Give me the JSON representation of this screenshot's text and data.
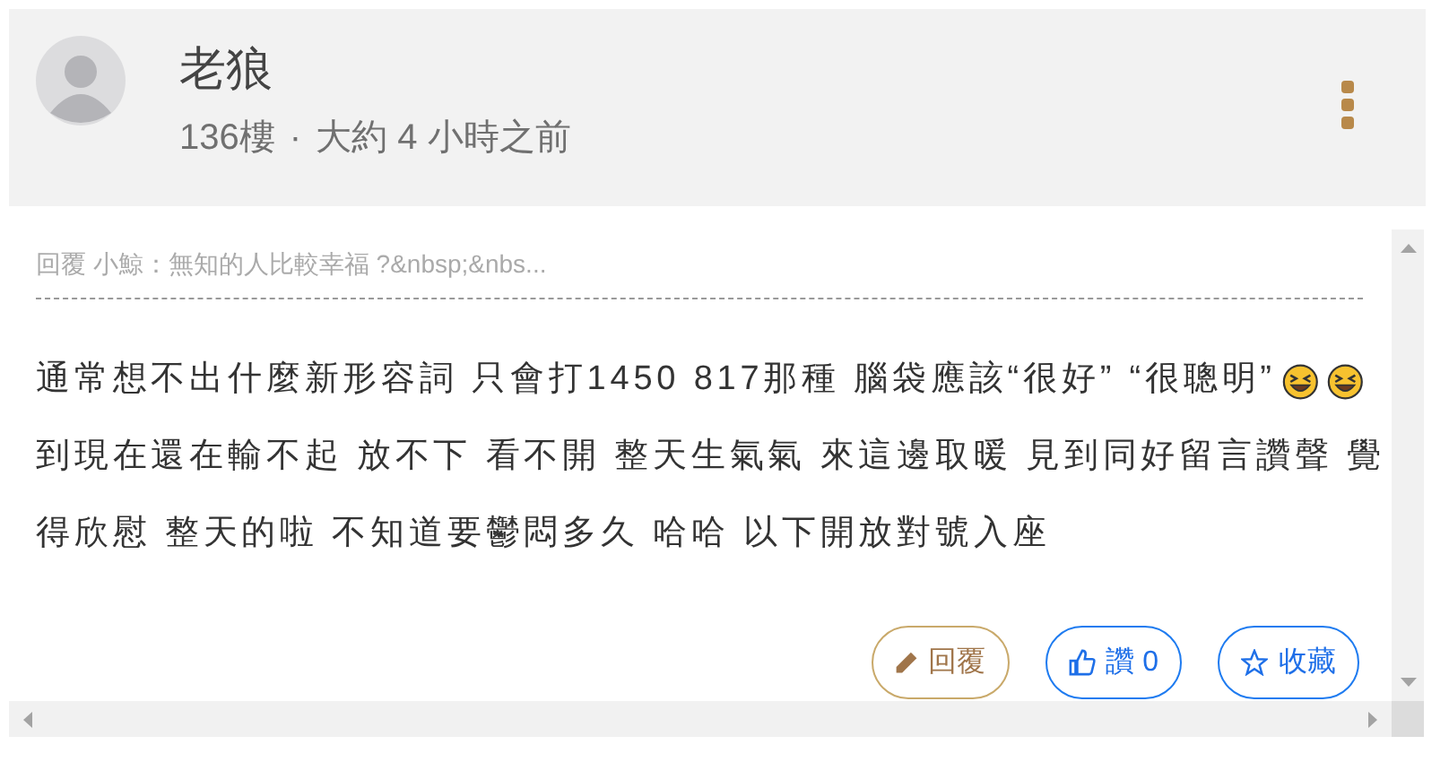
{
  "post": {
    "author": "老狼",
    "floor": "136樓",
    "separator": "·",
    "time": "大約 4 小時之前"
  },
  "reply_quote": "回覆 小鯨：無知的人比較幸福 ?&nbsp;&nbs...",
  "body_lines": [
    {
      "text": "通常想不出什麼新形容詞 只會打1450 817那種 腦袋應該“很好” “很聰明”",
      "emojis": [
        {
          "kind": "laughing"
        },
        {
          "kind": "laughing"
        }
      ]
    },
    {
      "text": "到現在還在輸不起 放不下 看不開 整天生氣氣 來這邊取暖 見到同好留言讚聲 覺"
    },
    {
      "text": "得欣慰 整天的啦 不知道要鬱悶多久 哈哈 以下開放對號入座"
    }
  ],
  "actions": [
    {
      "kind": "reply",
      "label": "回覆"
    },
    {
      "kind": "like",
      "label": "讚 0"
    },
    {
      "kind": "favorite",
      "label": "收藏"
    }
  ]
}
